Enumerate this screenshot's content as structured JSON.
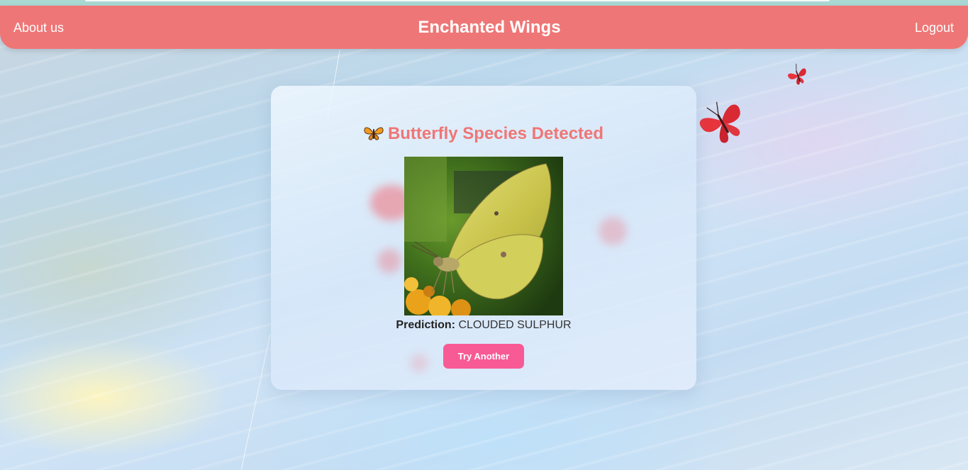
{
  "nav": {
    "left_link": "About us",
    "title": "Enchanted Wings",
    "right_link": "Logout"
  },
  "result": {
    "heading": "Butterfly Species Detected",
    "prediction_label": "Prediction:",
    "prediction_value": "CLOUDED SULPHUR",
    "button_label": "Try Another"
  },
  "icons": {
    "heading_icon": "butterfly-emoji-icon",
    "floating_large": "red-butterfly-icon",
    "floating_small": "red-butterfly-icon"
  },
  "colors": {
    "navbar": "#ef7676",
    "heading": "#ef7676",
    "button": "#f85a95"
  }
}
